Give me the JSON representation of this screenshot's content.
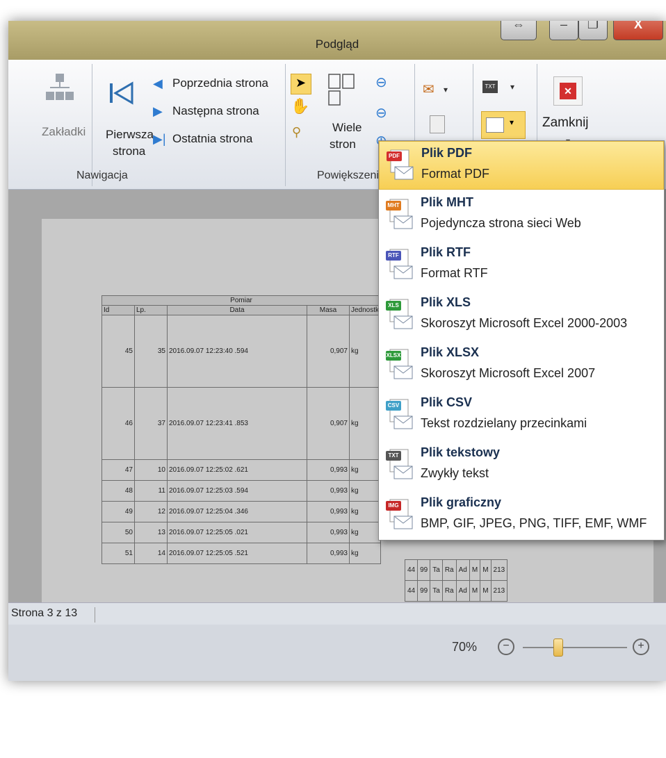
{
  "window": {
    "title": "Podgląd",
    "controls": {
      "resize": "⇔",
      "minimize": "–",
      "restore": "❐",
      "close": "X"
    }
  },
  "ribbon": {
    "bookmarks_label": "Zakładki",
    "first_page_label_1": "Pierwsza",
    "first_page_label_2": "strona",
    "prev_page": "Poprzednia strona",
    "next_page": "Następna strona",
    "last_page": "Ostatnia strona",
    "nav_group": "Nawigacja",
    "multi_pages_1": "Wiele",
    "multi_pages_2": "stron",
    "zoom_group": "Powiększeni",
    "close_label": "Zamknij",
    "dropdown_arrow": "▾"
  },
  "table": {
    "group_header": "Pomiar",
    "headers": [
      "Id",
      "Lp.",
      "Data",
      "Masa",
      "Jednostk"
    ],
    "rows": [
      [
        "45",
        "35",
        "2016.09.07  12:23:40 .594",
        "0,907",
        "kg"
      ],
      [
        "46",
        "37",
        "2016.09.07  12:23:41 .853",
        "0,907",
        "kg"
      ],
      [
        "47",
        "10",
        "2016.09.07  12:25:02 .621",
        "0,993",
        "kg"
      ],
      [
        "48",
        "11",
        "2016.09.07  12:25:03 .594",
        "0,993",
        "kg"
      ],
      [
        "49",
        "12",
        "2016.09.07  12:25:04 .346",
        "0,993",
        "kg"
      ],
      [
        "50",
        "13",
        "2016.09.07  12:25:05 .021",
        "0,993",
        "kg"
      ],
      [
        "51",
        "14",
        "2016.09.07  12:25:05 .521",
        "0,993",
        "kg"
      ]
    ],
    "right_cells": [
      "44",
      "99",
      "Ta",
      "Ra",
      "Ad",
      "M",
      "M",
      "213"
    ]
  },
  "status": {
    "page_info": "Strona 3 z 13",
    "zoom": "70%",
    "zoom_out": "−",
    "zoom_in": "+"
  },
  "export_menu": {
    "items": [
      {
        "title": "Plik PDF",
        "subtitle": "Format PDF",
        "badge": "PDF",
        "color": "#d32f2f"
      },
      {
        "title": "Plik MHT",
        "subtitle": "Pojedyncza strona sieci Web",
        "badge": "MHT",
        "color": "#e07b1f"
      },
      {
        "title": "Plik RTF",
        "subtitle": "Format RTF",
        "badge": "RTF",
        "color": "#4a55b8"
      },
      {
        "title": "Plik XLS",
        "subtitle": "Skoroszyt Microsoft Excel 2000-2003",
        "badge": "XLS",
        "color": "#2e9a3a"
      },
      {
        "title": "Plik XLSX",
        "subtitle": "Skoroszyt Microsoft Excel 2007",
        "badge": "XLSX",
        "color": "#2e9a3a"
      },
      {
        "title": "Plik CSV",
        "subtitle": "Tekst rozdzielany przecinkami",
        "badge": "CSV",
        "color": "#3fa0c8"
      },
      {
        "title": "Plik tekstowy",
        "subtitle": "Zwykły tekst",
        "badge": "TXT",
        "color": "#555555"
      },
      {
        "title": "Plik graficzny",
        "subtitle": "BMP, GIF, JPEG, PNG, TIFF, EMF, WMF",
        "badge": "IMG",
        "color": "#c62828"
      }
    ]
  }
}
